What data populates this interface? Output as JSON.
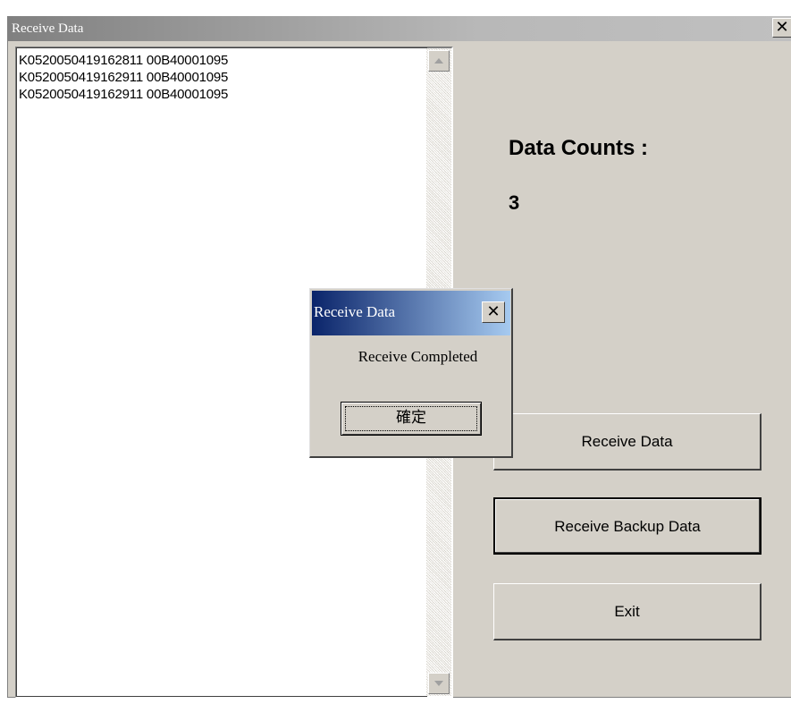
{
  "window": {
    "title": "Receive Data",
    "close_glyph": "✕"
  },
  "list": {
    "items": [
      "K0520050419162811 00B40001095",
      "K0520050419162911 00B40001095",
      "K0520050419162911 00B40001095"
    ]
  },
  "counts": {
    "label": "Data Counts :",
    "value": "3"
  },
  "buttons": {
    "receive": "Receive Data",
    "backup": "Receive Backup Data",
    "exit": "Exit"
  },
  "dialog": {
    "title": "Receive Data",
    "message": "Receive Completed",
    "ok": "確定",
    "close_glyph": "✕"
  }
}
